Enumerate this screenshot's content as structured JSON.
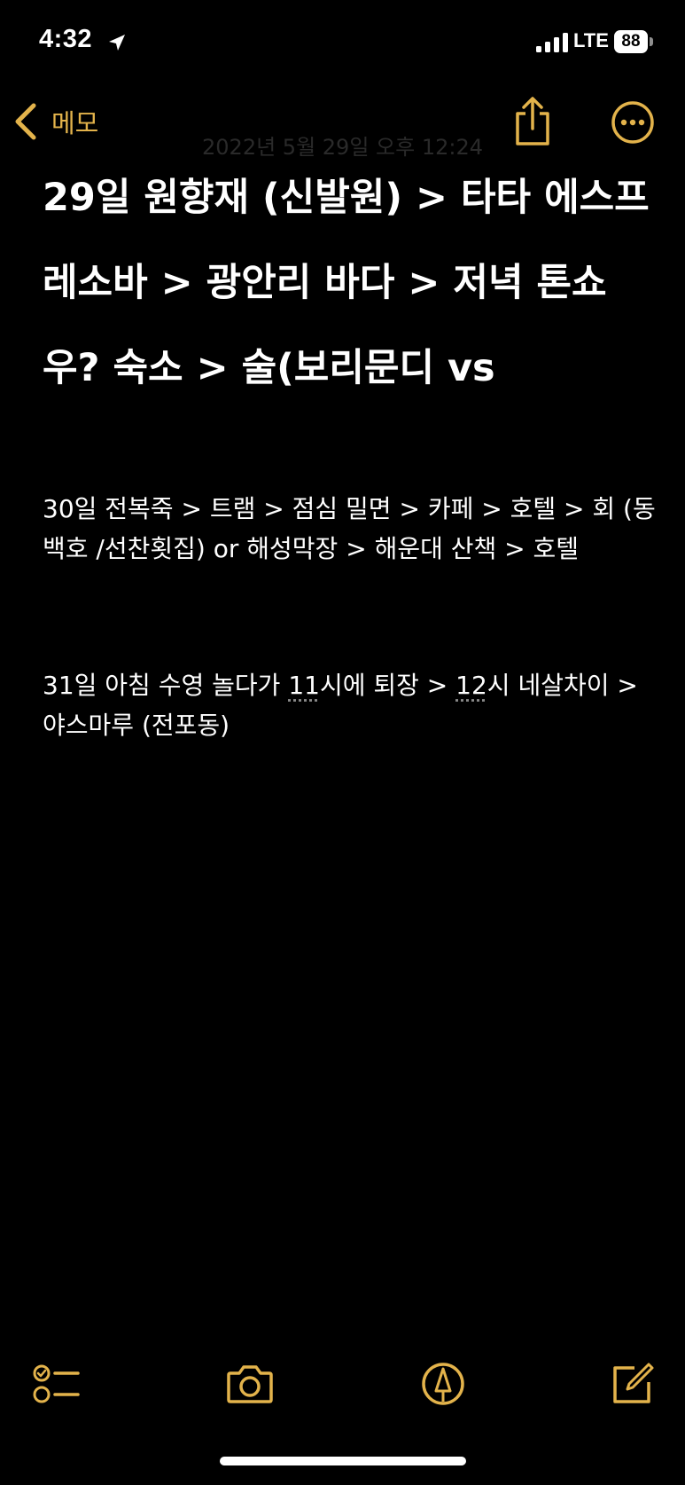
{
  "status_bar": {
    "time": "4:32",
    "network": "LTE",
    "battery": "88",
    "location_icon": "location-arrow-icon",
    "signal_icon": "cellular-signal-icon"
  },
  "nav": {
    "back_label": "메모",
    "share_icon": "share-icon",
    "more_icon": "more-ellipsis-icon"
  },
  "note": {
    "date": "2022년 5월 29일 오후 12:24",
    "title": "29일 원향재 (신발원) > 타타 에스프레소바 > 광안리 바다 > 저녁 톤쇼우? 숙소 > 술(보리문디 vs",
    "para1": "30일 전복죽 > 트램 > 점심 밀면 > 카페 > 호텔 > 회 (동백호 /선찬횟집) or 해성막장 > 해운대 산책 > 호텔",
    "para2": {
      "part1": "31일 아침 수영 놀다가 ",
      "time1": "11",
      "part2": "시에 퇴장 > ",
      "time2": "12",
      "part3": "시 네살차이 >  야스마루  (전포동)"
    }
  },
  "toolbar": {
    "checklist_icon": "checklist-icon",
    "camera_icon": "camera-icon",
    "markup_icon": "markup-pen-icon",
    "compose_icon": "compose-icon"
  },
  "colors": {
    "accent": "#e3b34b",
    "background": "#000000",
    "text": "#ffffff"
  }
}
